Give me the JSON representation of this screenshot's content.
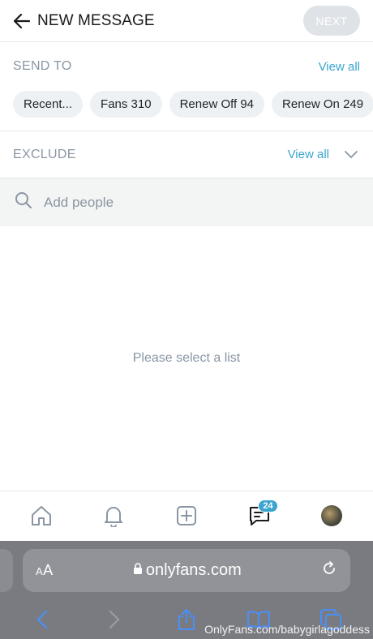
{
  "header": {
    "title": "NEW MESSAGE",
    "next_label": "NEXT"
  },
  "send_to": {
    "label": "SEND TO",
    "view_all": "View all",
    "chips": [
      "Recent...",
      "Fans 310",
      "Renew Off 94",
      "Renew On 249"
    ]
  },
  "exclude": {
    "label": "EXCLUDE",
    "view_all": "View all"
  },
  "search": {
    "placeholder": "Add people"
  },
  "empty_state": {
    "text": "Please select a list"
  },
  "bottom_nav": {
    "messages_badge": "24"
  },
  "browser": {
    "aa_small": "A",
    "aa_large": "A",
    "url": "onlyfans.com"
  },
  "watermark": "OnlyFans.com/babygirlagoddess",
  "colors": {
    "accent": "#3aa5cf",
    "muted": "#8a96a3",
    "next_disabled": "#dfe3e7",
    "safari_bar": "#7a7b80"
  }
}
